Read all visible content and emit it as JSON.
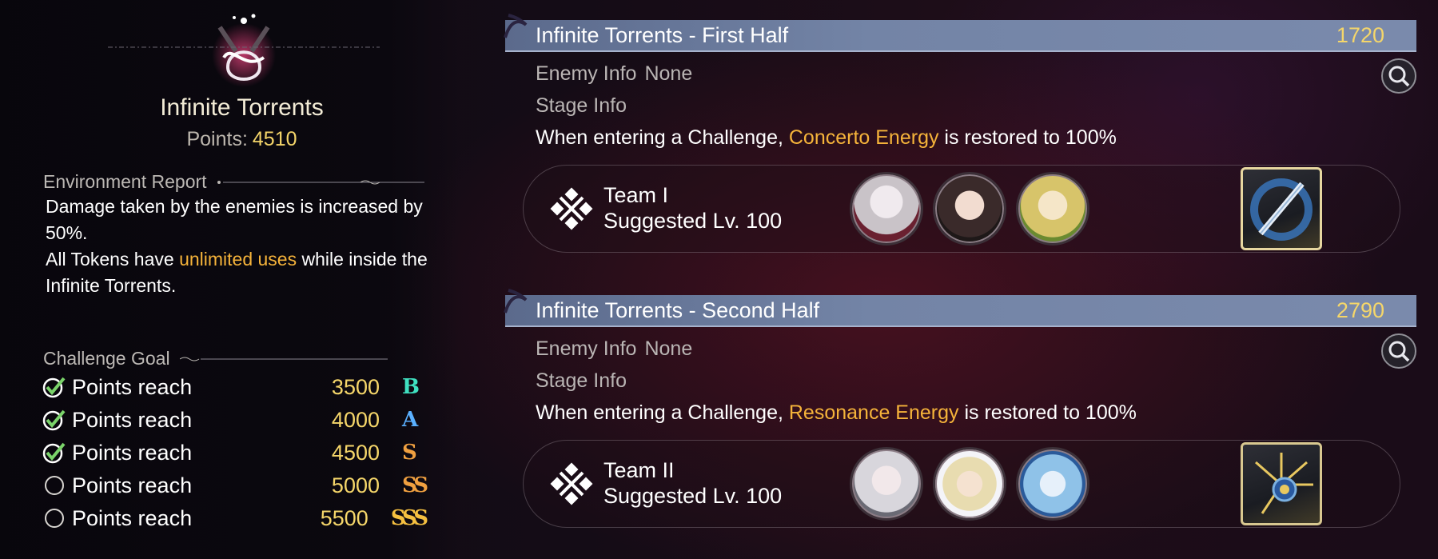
{
  "left": {
    "stage_title": "Infinite Torrents",
    "points_label": "Points:",
    "points_value": "4510",
    "environment": {
      "heading": "Environment Report",
      "line1": "Damage taken by the enemies is increased by 50%.",
      "line2_pre": "All Tokens have ",
      "line2_hl": "unlimited uses",
      "line2_post": " while inside the Infinite Torrents."
    },
    "goals": {
      "heading": "Challenge Goal",
      "items": [
        {
          "label": "Points reach",
          "value": "3500",
          "rank": "B",
          "done": true,
          "rank_color": "#3fe0c0"
        },
        {
          "label": "Points reach",
          "value": "4000",
          "rank": "A",
          "done": true,
          "rank_color": "#5ab0ff"
        },
        {
          "label": "Points reach",
          "value": "4500",
          "rank": "S",
          "done": true,
          "rank_color": "#f0a040"
        },
        {
          "label": "Points reach",
          "value": "5000",
          "rank": "SS",
          "done": false,
          "rank_color": "#f0a040"
        },
        {
          "label": "Points reach",
          "value": "5500",
          "rank": "SSS",
          "done": false,
          "rank_color": "#f5c040"
        }
      ]
    }
  },
  "halves": [
    {
      "title": "Infinite Torrents - First Half",
      "score": "1720",
      "enemy_label": "Enemy Info",
      "enemy_value": "None",
      "stage_label": "Stage Info",
      "desc_pre": "When entering a Challenge, ",
      "desc_hl": "Concerto Energy",
      "desc_post": " is restored to 100%",
      "team_name": "Team I",
      "team_level": "Suggested Lv. 100",
      "avatars": [
        "#c9c3c8",
        "#3a2a2a",
        "#d7c46a"
      ]
    },
    {
      "title": "Infinite Torrents - Second Half",
      "score": "2790",
      "enemy_label": "Enemy Info",
      "enemy_value": "None",
      "stage_label": "Stage Info",
      "desc_pre": "When entering a Challenge, ",
      "desc_hl": "Resonance Energy",
      "desc_post": " is restored to 100%",
      "team_name": "Team II",
      "team_level": "Suggested Lv. 100",
      "avatars": [
        "#d8d6dc",
        "#e8dcb0",
        "#8fc2e8"
      ]
    }
  ],
  "colors": {
    "highlight": "#f5b33a",
    "score_gold": "#f5d66a",
    "banner": "#7384a6"
  },
  "icons": [
    "infinity-emblem-icon",
    "check-icon",
    "empty-circle-icon",
    "search-icon",
    "team-diamond-icon",
    "echo-icon"
  ]
}
